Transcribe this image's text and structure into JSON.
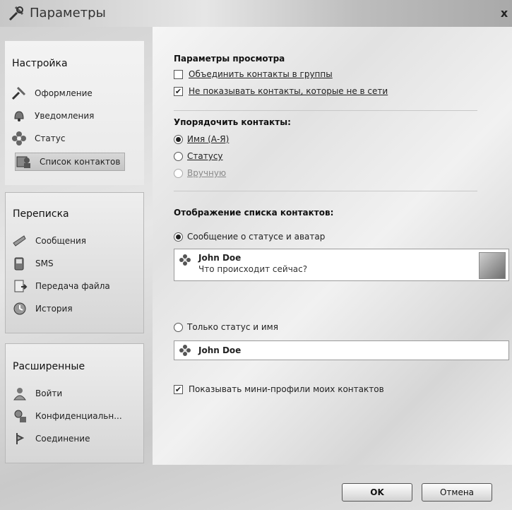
{
  "window": {
    "title": "Параметры",
    "close_glyph": "x"
  },
  "sidebar": {
    "groups": [
      {
        "title": "Настройка",
        "items": [
          {
            "label": "Оформление",
            "icon": "tools-icon"
          },
          {
            "label": "Уведомления",
            "icon": "bell-icon"
          },
          {
            "label": "Статус",
            "icon": "flower-status-icon"
          },
          {
            "label": "Список контактов",
            "icon": "contacts-icon",
            "selected": true
          }
        ]
      },
      {
        "title": "Переписка",
        "items": [
          {
            "label": "Сообщения",
            "icon": "message-icon"
          },
          {
            "label": "SMS",
            "icon": "sms-icon"
          },
          {
            "label": "Передача файла",
            "icon": "file-transfer-icon"
          },
          {
            "label": "История",
            "icon": "history-icon"
          }
        ]
      },
      {
        "title": "Расширенные",
        "items": [
          {
            "label": "Войти",
            "icon": "login-icon"
          },
          {
            "label": "Конфиденциальн...",
            "icon": "privacy-icon"
          },
          {
            "label": "Соединение",
            "icon": "connection-icon"
          }
        ]
      }
    ]
  },
  "view_options": {
    "title": "Параметры просмотра",
    "group_contacts": {
      "label": "Объединить контакты в группы",
      "checked": false
    },
    "hide_offline": {
      "label": "Не показывать контакты, которые не в сети",
      "checked": true
    }
  },
  "sort": {
    "title": "Упорядочить контакты:",
    "options": [
      {
        "label": "Имя (А-Я)",
        "selected": true,
        "enabled": true
      },
      {
        "label": "Статусу",
        "selected": false,
        "enabled": true
      },
      {
        "label": "Вручную",
        "selected": false,
        "enabled": false
      }
    ]
  },
  "display": {
    "title": "Отображение списка контактов:",
    "full": {
      "label": "Сообщение о статусе и аватар",
      "selected": true
    },
    "preview_full": {
      "name": "John Doe",
      "status": "Что происходит сейчас?"
    },
    "compact": {
      "label": "Только статус и имя",
      "selected": false
    },
    "preview_compact": {
      "name": "John Doe"
    },
    "mini_profiles": {
      "label": "Показывать мини-профили моих контактов",
      "checked": true
    }
  },
  "buttons": {
    "ok": "OK",
    "cancel": "Отмена"
  },
  "colors": {
    "window_bg": "#d9d9d9",
    "panel_border": "#b8b8b8",
    "preview_bg": "#ffffff"
  }
}
